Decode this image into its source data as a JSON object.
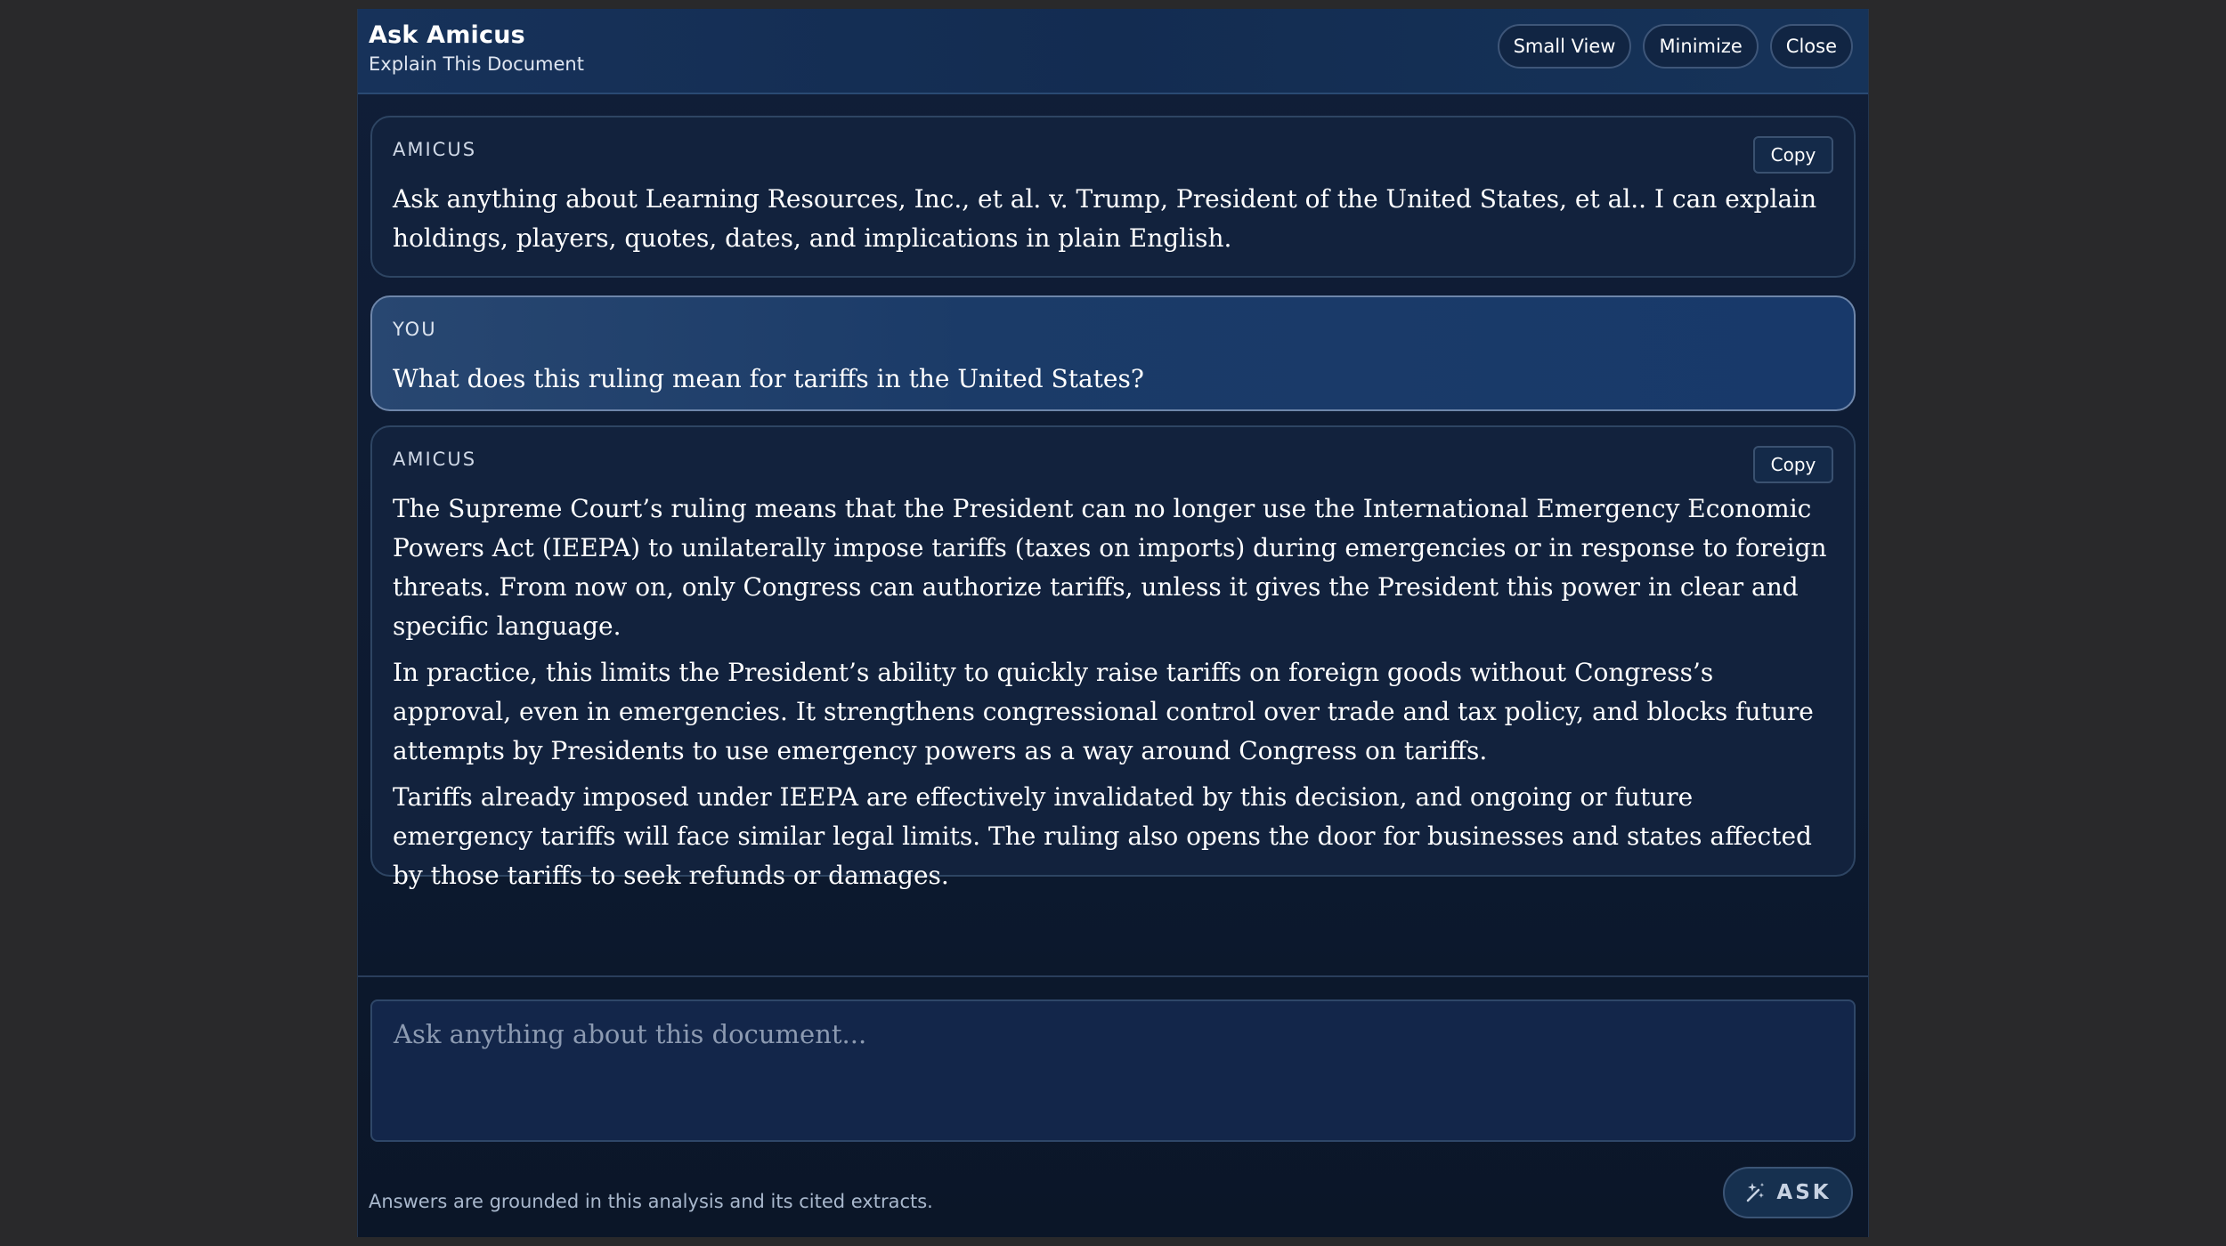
{
  "header": {
    "title": "Ask Amicus",
    "subtitle": "Explain This Document",
    "buttons": {
      "small_view": "Small View",
      "minimize": "Minimize",
      "close": "Close"
    }
  },
  "messages": [
    {
      "role": "AMICUS",
      "copy_label": "Copy",
      "text": "Ask anything about Learning Resources, Inc., et al. v. Trump, President of the United States, et al.. I can explain holdings, players, quotes, dates, and implications in plain English."
    },
    {
      "role": "YOU",
      "text": "What does this ruling mean for tariffs in the United States?"
    },
    {
      "role": "AMICUS",
      "copy_label": "Copy",
      "paragraphs": [
        "The Supreme Court’s ruling means that the President can no longer use the International Emergency Economic Powers Act (IEEPA) to unilaterally impose tariffs (taxes on imports) during emergencies or in response to foreign threats. From now on, only Congress can authorize tariffs, unless it gives the President this power in clear and specific language.",
        "In practice, this limits the President’s ability to quickly raise tariffs on foreign goods without Congress’s approval, even in emergencies. It strengthens congressional control over trade and tax policy, and blocks future attempts by Presidents to use emergency powers as a way around Congress on tariffs.",
        "Tariffs already imposed under IEEPA are effectively invalidated by this decision, and ongoing or future emergency tariffs will face similar legal limits. The ruling also opens the door for businesses and states affected by those tariffs to seek refunds or damages."
      ]
    }
  ],
  "composer": {
    "placeholder": "Ask anything about this document...",
    "value": ""
  },
  "footer": {
    "note": "Answers are grounded in this analysis and its cited extracts.",
    "ask_label": "ASK",
    "ask_icon": "sparkle-wand-icon"
  },
  "colors": {
    "page_background": "#29292b",
    "panel_background": "#0d1a30",
    "header_background": "#152f55",
    "user_bubble": "#1b3b68",
    "text": "#ffffff",
    "muted_text": "#a9b8cd"
  }
}
